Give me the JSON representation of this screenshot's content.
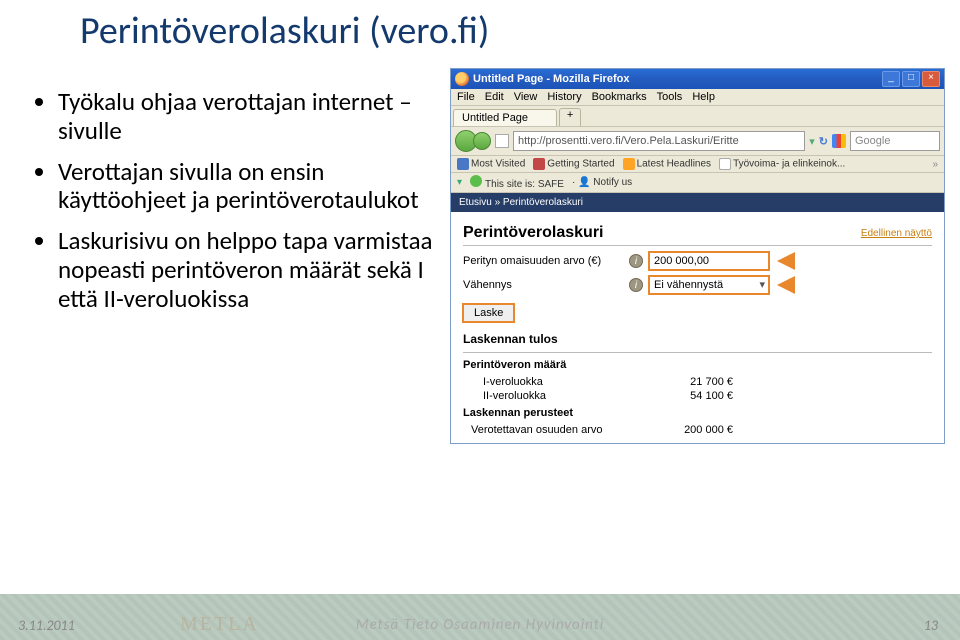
{
  "title": "Perintöverolaskuri (vero.fi)",
  "bullets": [
    "Työkalu ohjaa verottajan internet –sivulle",
    "Verottajan sivulla on ensin käyttöohjeet ja perintöverotaulukot",
    "Laskurisivu on helppo tapa varmistaa nopeasti perintöveron määrät sekä I että II-veroluokissa"
  ],
  "firefox": {
    "window_title": "Untitled Page - Mozilla Firefox",
    "menu": [
      "File",
      "Edit",
      "View",
      "History",
      "Bookmarks",
      "Tools",
      "Help"
    ],
    "tab_label": "Untitled Page",
    "tab_plus": "+",
    "url": "http://prosentti.vero.fi/Vero.Pela.Laskuri/Eritte",
    "search_placeholder": "Google",
    "bookmarks": [
      "Most Visited",
      "Getting Started",
      "Latest Headlines",
      "Työvoima- ja elinkeinok..."
    ],
    "safebar": {
      "safe": "This site is: SAFE",
      "notify": "Notify us"
    },
    "overflow": "»"
  },
  "page": {
    "breadcrumb": "Etusivu » Perintöverolaskuri",
    "heading": "Perintöverolaskuri",
    "prev_link": "Edellinen näyttö",
    "row1_label": "Perityn omaisuuden arvo (€)",
    "row1_value": "200 000,00",
    "row2_label": "Vähennys",
    "row2_value": "Ei vähennystä",
    "info_glyph": "i",
    "calc_button": "Laske",
    "result_heading": "Laskennan tulos",
    "tax_heading": "Perintöveron määrä",
    "class1_label": "I-veroluokka",
    "class1_value": "21 700 €",
    "class2_label": "II-veroluokka",
    "class2_value": "54 100 €",
    "basis_heading": "Laskennan perusteet",
    "basis_label": "Verotettavan osuuden arvo",
    "basis_value": "200 000 €"
  },
  "footer": {
    "date": "3.11.2011",
    "logo": "METLA",
    "words": "Metsä   Tieto   Osaaminen   Hyvinvointi",
    "page_num": "13"
  }
}
